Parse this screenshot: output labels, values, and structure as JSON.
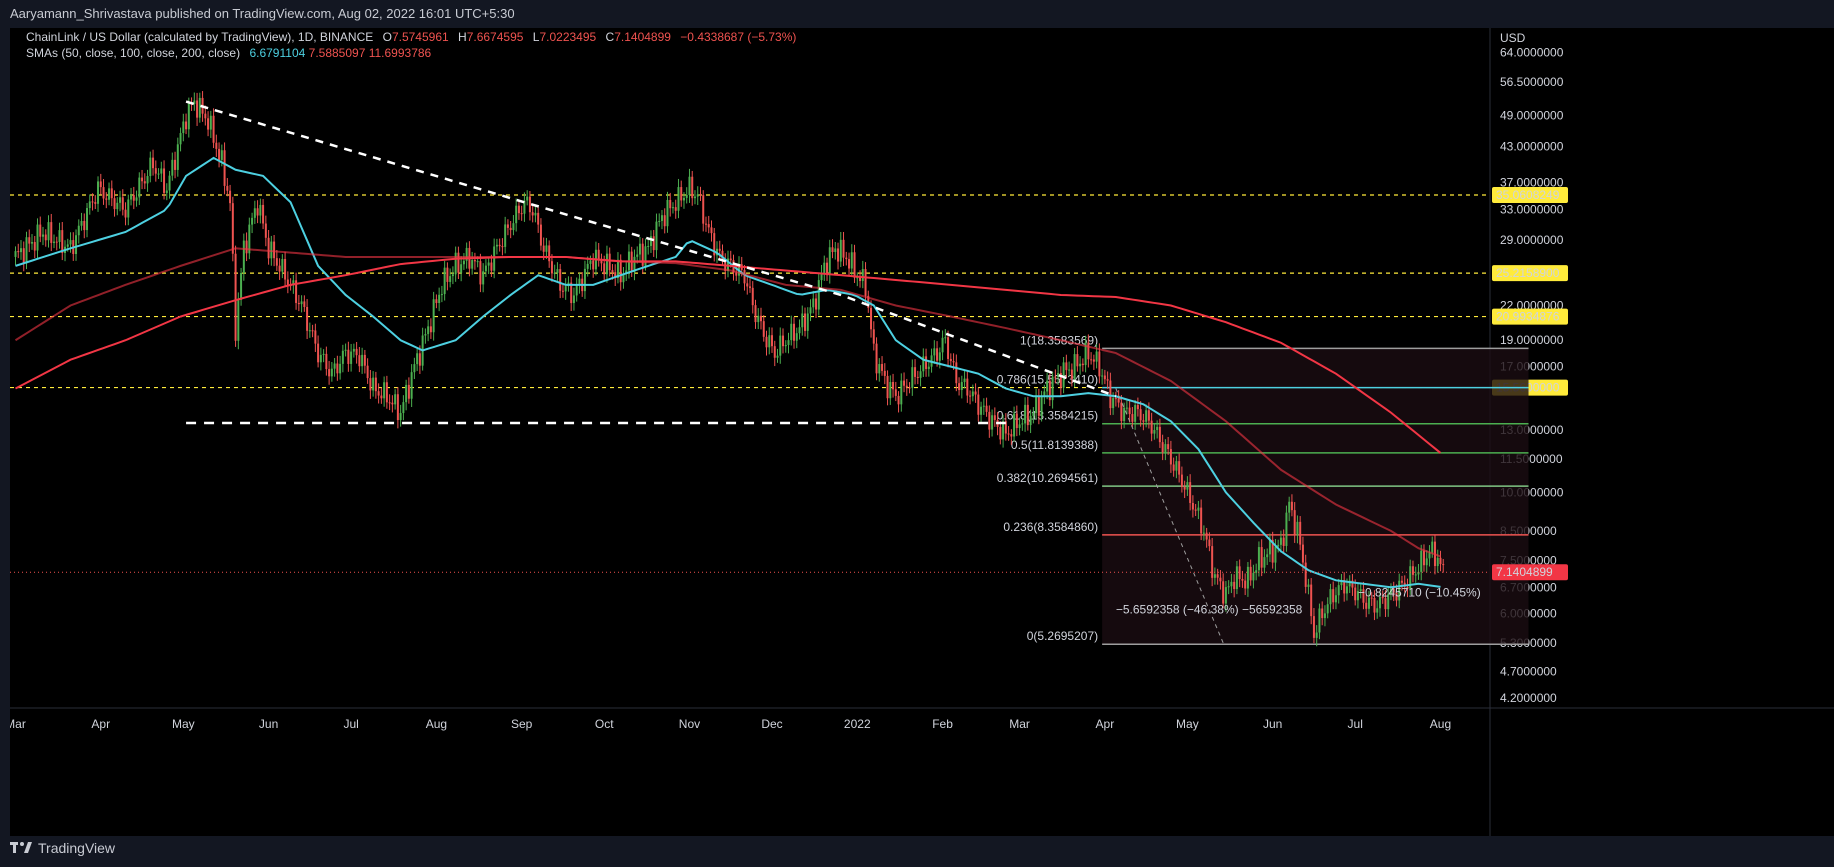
{
  "header": {
    "published": "Aaryamann_Shrivastava published on TradingView.com, Aug 02, 2022 16:01 UTC+5:30"
  },
  "legend": {
    "title": "ChainLink / US Dollar (calculated by TradingView), 1D, BINANCE",
    "o_label": "O",
    "o_value": "7.5745961",
    "h_label": "H",
    "h_value": "7.6674595",
    "l_label": "L",
    "l_value": "7.0223495",
    "c_label": "C",
    "c_value": "7.1404899",
    "change": "−0.4338687 (−5.73%)",
    "sma_label": "SMAs (50, close, 100, close, 200, close)",
    "sma_values": [
      "6.6791104",
      "7.5885097",
      "11.6993786"
    ]
  },
  "footer": {
    "brand": "TradingView"
  },
  "colors": {
    "up": "#26a69a",
    "down": "#ef5350",
    "sma_short": "#4dd0e1",
    "sma_long": "#f23645",
    "level": "#ffeb3b"
  },
  "chart_data": {
    "type": "line",
    "currency": "USD",
    "y_scale": "log",
    "ylim": [
      4.2,
      68
    ],
    "y_ticks": [
      {
        "v": 64,
        "label": "64.0000000"
      },
      {
        "v": 56.5,
        "label": "56.5000000"
      },
      {
        "v": 49,
        "label": "49.0000000"
      },
      {
        "v": 43,
        "label": "43.0000000"
      },
      {
        "v": 37,
        "label": "37.0000000"
      },
      {
        "v": 33,
        "label": "33.0000000"
      },
      {
        "v": 29,
        "label": "29.0000000"
      },
      {
        "v": 22,
        "label": "22.0000000"
      },
      {
        "v": 19,
        "label": "19.0000000"
      },
      {
        "v": 17,
        "label": "17.0000000"
      },
      {
        "v": 13,
        "label": "13.0000000"
      },
      {
        "v": 11.5,
        "label": "11.5000000"
      },
      {
        "v": 10,
        "label": "10.0000000"
      },
      {
        "v": 8.5,
        "label": "8.5000000"
      },
      {
        "v": 7.5,
        "label": "7.5000000"
      },
      {
        "v": 6.7,
        "label": "6.7000000"
      },
      {
        "v": 6,
        "label": "6.0000000"
      },
      {
        "v": 5.3,
        "label": "5.3000000"
      },
      {
        "v": 4.7,
        "label": "4.7000000"
      },
      {
        "v": 4.2,
        "label": "4.2000000"
      }
    ],
    "x_ticks": [
      {
        "t": 0,
        "label": "Mar"
      },
      {
        "t": 31,
        "label": "Apr"
      },
      {
        "t": 61,
        "label": "May"
      },
      {
        "t": 92,
        "label": "Jun"
      },
      {
        "t": 122,
        "label": "Jul"
      },
      {
        "t": 153,
        "label": "Aug"
      },
      {
        "t": 184,
        "label": "Sep"
      },
      {
        "t": 214,
        "label": "Oct"
      },
      {
        "t": 245,
        "label": "Nov"
      },
      {
        "t": 275,
        "label": "Dec"
      },
      {
        "t": 306,
        "label": "2022"
      },
      {
        "t": 337,
        "label": "Feb"
      },
      {
        "t": 365,
        "label": "Mar"
      },
      {
        "t": 396,
        "label": "Apr"
      },
      {
        "t": 426,
        "label": "May"
      },
      {
        "t": 457,
        "label": "Jun"
      },
      {
        "t": 487,
        "label": "Jul"
      },
      {
        "t": 518,
        "label": "Aug"
      }
    ],
    "price_path": [
      [
        0,
        27
      ],
      [
        10,
        30
      ],
      [
        20,
        28
      ],
      [
        30,
        36
      ],
      [
        40,
        33
      ],
      [
        50,
        40
      ],
      [
        55,
        36
      ],
      [
        62,
        49
      ],
      [
        65,
        52
      ],
      [
        70,
        48
      ],
      [
        75,
        40
      ],
      [
        78,
        34
      ],
      [
        80,
        20
      ],
      [
        83,
        28
      ],
      [
        88,
        34
      ],
      [
        92,
        28
      ],
      [
        98,
        25
      ],
      [
        104,
        22
      ],
      [
        110,
        18
      ],
      [
        115,
        16.5
      ],
      [
        120,
        18
      ],
      [
        125,
        17.8
      ],
      [
        130,
        15.5
      ],
      [
        135,
        15
      ],
      [
        140,
        14
      ],
      [
        145,
        17
      ],
      [
        150,
        20
      ],
      [
        155,
        24
      ],
      [
        160,
        26
      ],
      [
        165,
        27
      ],
      [
        170,
        25
      ],
      [
        175,
        28
      ],
      [
        180,
        31
      ],
      [
        185,
        34
      ],
      [
        188,
        33
      ],
      [
        192,
        28
      ],
      [
        198,
        24
      ],
      [
        203,
        23
      ],
      [
        210,
        27
      ],
      [
        215,
        26
      ],
      [
        220,
        25
      ],
      [
        225,
        27
      ],
      [
        230,
        28
      ],
      [
        235,
        32
      ],
      [
        240,
        34
      ],
      [
        245,
        36
      ],
      [
        248,
        35
      ],
      [
        252,
        30
      ],
      [
        256,
        27
      ],
      [
        260,
        26
      ],
      [
        265,
        25
      ],
      [
        268,
        22
      ],
      [
        272,
        19.5
      ],
      [
        276,
        18
      ],
      [
        280,
        19
      ],
      [
        285,
        20
      ],
      [
        290,
        22
      ],
      [
        294,
        26
      ],
      [
        298,
        28
      ],
      [
        302,
        27
      ],
      [
        306,
        25
      ],
      [
        309,
        24
      ],
      [
        312,
        18
      ],
      [
        316,
        16
      ],
      [
        320,
        15
      ],
      [
        325,
        16
      ],
      [
        330,
        17
      ],
      [
        335,
        18
      ],
      [
        338,
        19
      ],
      [
        342,
        16
      ],
      [
        346,
        15.5
      ],
      [
        350,
        14.5
      ],
      [
        355,
        13.5
      ],
      [
        360,
        12.8
      ],
      [
        365,
        13.5
      ],
      [
        370,
        14
      ],
      [
        375,
        15.5
      ],
      [
        380,
        16.5
      ],
      [
        385,
        17
      ],
      [
        390,
        18
      ],
      [
        394,
        17
      ],
      [
        398,
        15
      ],
      [
        403,
        14
      ],
      [
        408,
        14
      ],
      [
        412,
        13.5
      ],
      [
        416,
        12.5
      ],
      [
        420,
        11.5
      ],
      [
        424,
        10.5
      ],
      [
        428,
        9.5
      ],
      [
        432,
        8.5
      ],
      [
        436,
        7
      ],
      [
        440,
        6.5
      ],
      [
        443,
        7
      ],
      [
        448,
        6.9
      ],
      [
        452,
        7.5
      ],
      [
        456,
        7.8
      ],
      [
        460,
        8
      ],
      [
        463,
        9.5
      ],
      [
        466,
        8.5
      ],
      [
        469,
        7
      ],
      [
        472,
        5.5
      ],
      [
        475,
        6
      ],
      [
        479,
        6.5
      ],
      [
        483,
        6.8
      ],
      [
        487,
        6.6
      ],
      [
        491,
        6.3
      ],
      [
        495,
        6.2
      ],
      [
        500,
        6.5
      ],
      [
        505,
        6.8
      ],
      [
        510,
        7.3
      ],
      [
        514,
        7.8
      ],
      [
        517,
        7.6
      ],
      [
        519,
        7.1
      ]
    ],
    "series": [
      {
        "points": [
          [
            0,
            26
          ],
          [
            20,
            28
          ],
          [
            40,
            30
          ],
          [
            55,
            33
          ],
          [
            62,
            38
          ],
          [
            72,
            41
          ],
          [
            80,
            39
          ],
          [
            90,
            38
          ],
          [
            100,
            34
          ],
          [
            110,
            26
          ],
          [
            120,
            23
          ],
          [
            130,
            21
          ],
          [
            140,
            19
          ],
          [
            148,
            18.2
          ],
          [
            160,
            19
          ],
          [
            170,
            21
          ],
          [
            180,
            23
          ],
          [
            190,
            25
          ],
          [
            200,
            24
          ],
          [
            210,
            24
          ],
          [
            220,
            25
          ],
          [
            230,
            26
          ],
          [
            240,
            27
          ],
          [
            245,
            29
          ],
          [
            255,
            27.5
          ],
          [
            265,
            25
          ],
          [
            275,
            24
          ],
          [
            285,
            23
          ],
          [
            295,
            23.5
          ],
          [
            305,
            23
          ],
          [
            312,
            22
          ],
          [
            320,
            19
          ],
          [
            330,
            17.5
          ],
          [
            340,
            17
          ],
          [
            350,
            16.5
          ],
          [
            360,
            15.5
          ],
          [
            370,
            15
          ],
          [
            380,
            15
          ],
          [
            390,
            15.2
          ],
          [
            400,
            15
          ],
          [
            410,
            14.5
          ],
          [
            420,
            13.5
          ],
          [
            430,
            12
          ],
          [
            440,
            10
          ],
          [
            450,
            8.8
          ],
          [
            460,
            7.8
          ],
          [
            470,
            7.2
          ],
          [
            480,
            6.9
          ],
          [
            490,
            6.8
          ],
          [
            500,
            6.7
          ],
          [
            510,
            6.8
          ],
          [
            519,
            6.7
          ]
        ]
      },
      {
        "points": [
          [
            0,
            19
          ],
          [
            20,
            22
          ],
          [
            40,
            24
          ],
          [
            60,
            26
          ],
          [
            80,
            28
          ],
          [
            100,
            27.5
          ],
          [
            120,
            27
          ],
          [
            140,
            27
          ],
          [
            160,
            27
          ],
          [
            180,
            27
          ],
          [
            200,
            27
          ],
          [
            220,
            26.5
          ],
          [
            240,
            26.3
          ],
          [
            260,
            25.5
          ],
          [
            280,
            24
          ],
          [
            300,
            23.5
          ],
          [
            320,
            22
          ],
          [
            340,
            21
          ],
          [
            360,
            20
          ],
          [
            380,
            19
          ],
          [
            400,
            18
          ],
          [
            420,
            16
          ],
          [
            440,
            13.5
          ],
          [
            460,
            11
          ],
          [
            480,
            9.5
          ],
          [
            500,
            8.5
          ],
          [
            510,
            7.9
          ],
          [
            519,
            7.6
          ]
        ]
      },
      {
        "points": [
          [
            0,
            15.5
          ],
          [
            20,
            17.5
          ],
          [
            40,
            19
          ],
          [
            60,
            21
          ],
          [
            80,
            22.5
          ],
          [
            100,
            24
          ],
          [
            120,
            25
          ],
          [
            140,
            26.2
          ],
          [
            160,
            26.8
          ],
          [
            180,
            27
          ],
          [
            200,
            27
          ],
          [
            220,
            26.5
          ],
          [
            240,
            26.5
          ],
          [
            260,
            26
          ],
          [
            280,
            25.5
          ],
          [
            300,
            25
          ],
          [
            320,
            24.5
          ],
          [
            340,
            24
          ],
          [
            360,
            23.5
          ],
          [
            380,
            23
          ],
          [
            400,
            22.8
          ],
          [
            420,
            22
          ],
          [
            440,
            20.5
          ],
          [
            460,
            18.8
          ],
          [
            480,
            16.5
          ],
          [
            500,
            14
          ],
          [
            519,
            11.7
          ]
        ]
      }
    ],
    "levels": [
      {
        "v": 35.0608249,
        "label": "35.0608249"
      },
      {
        "v": 25.21589,
        "label": "25.2158900"
      },
      {
        "v": 20.9934876,
        "label": "20.9934876"
      },
      {
        "v": 15.56,
        "label": "15.5600000"
      }
    ],
    "fib": {
      "t_start": 395,
      "t_end": 550,
      "levels": [
        {
          "v": 18.3583569,
          "label": "1(18.3583569)",
          "color": "#9e9e9e"
        },
        {
          "v": 15.557341,
          "label": "0.786(15.5573410)",
          "color": "#4dd0e1"
        },
        {
          "v": 13.3584215,
          "label": "0.618(13.3584215)",
          "color": "#4caf50"
        },
        {
          "v": 11.8139388,
          "label": "0.5(11.8139388)",
          "color": "#4caf50"
        },
        {
          "v": 10.2694561,
          "label": "0.382(10.2694561)",
          "color": "#81c784"
        },
        {
          "v": 8.358486,
          "label": "0.236(8.3584860)",
          "color": "#ef5350"
        },
        {
          "v": 5.2695207,
          "label": "0(5.2695207)",
          "color": "#9e9e9e"
        }
      ]
    },
    "trendline_down": [
      [
        62,
        52
      ],
      [
        185,
        34
      ],
      [
        300,
        23
      ],
      [
        400,
        15
      ]
    ],
    "support_line": {
      "t1": 62,
      "t2": 360,
      "v": 13.4
    },
    "measure_annotations": [
      {
        "label": "−5.6592358 (−46.38%) −56592358",
        "color": "#ef5350"
      },
      {
        "label": "−0.8245710 (−10.45%)",
        "color": "#4caf50"
      }
    ],
    "last_price": {
      "v": 7.1404899,
      "label": "7.1404899"
    }
  }
}
